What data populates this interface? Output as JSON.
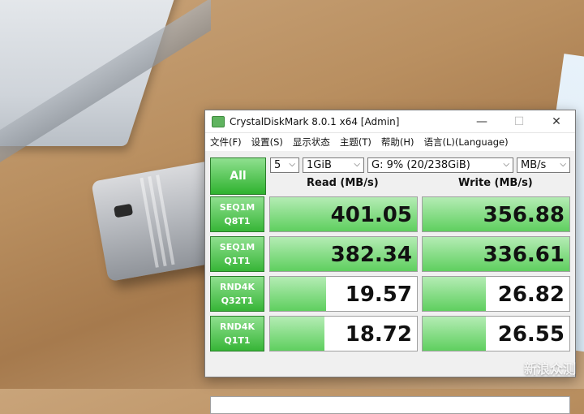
{
  "window": {
    "title": "CrystalDiskMark 8.0.1 x64 [Admin]",
    "minimize": "—",
    "maximize": "☐",
    "close": "✕"
  },
  "menu": [
    "文件(F)",
    "设置(S)",
    "显示状态",
    "主题(T)",
    "帮助(H)",
    "语言(L)(Language)"
  ],
  "controls": {
    "all_label": "All",
    "count": "5",
    "size": "1GiB",
    "drive": "G: 9% (20/238GiB)",
    "unit": "MB/s"
  },
  "headers": {
    "read": "Read (MB/s)",
    "write": "Write (MB/s)"
  },
  "rows": [
    {
      "test": "SEQ1M",
      "params": "Q8T1",
      "read": "401.05",
      "write": "356.88",
      "read_fill": 1.0,
      "write_fill": 1.0
    },
    {
      "test": "SEQ1M",
      "params": "Q1T1",
      "read": "382.34",
      "write": "336.61",
      "read_fill": 1.0,
      "write_fill": 1.0
    },
    {
      "test": "RND4K",
      "params": "Q32T1",
      "read": "19.57",
      "write": "26.82",
      "read_fill": 0.38,
      "write_fill": 0.43
    },
    {
      "test": "RND4K",
      "params": "Q1T1",
      "read": "18.72",
      "write": "26.55",
      "read_fill": 0.37,
      "write_fill": 0.43
    }
  ],
  "status": "",
  "watermark": "新浪众测"
}
